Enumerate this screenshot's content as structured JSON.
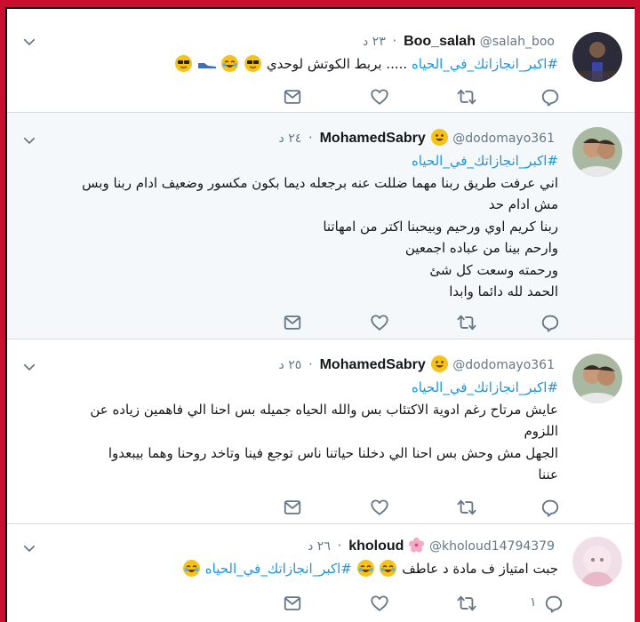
{
  "tweets": [
    {
      "name": "Boo_salah",
      "handle": "@salah_boo",
      "time": "٢٣ د",
      "tag": "#اكبر_انجازاتك_في_الحياه",
      "lines": [],
      "inline_text": "..... بربط الكوتش لوحدي",
      "reply_count": ""
    },
    {
      "name": "MohamedSabry",
      "handle": "@dodomayo361",
      "time": "٢٤ د",
      "tag": "#اكبر_انجازاتك_في_الحياه",
      "lines": [
        "اني عرفت طريق ربنا مهما ضللت عنه برجعله ديما بكون مكسور وضعيف ادام ربنا وبس",
        "مش ادام حد",
        "ربنا كريم اوي ورحيم وبيحبنا اكتر من امهاتنا",
        "وارحم بينا من عباده اجمعين",
        "ورحمته وسعت كل شئ",
        "الحمد لله دائما وابدا"
      ],
      "reply_count": ""
    },
    {
      "name": "MohamedSabry",
      "handle": "@dodomayo361",
      "time": "٢٥ د",
      "tag": "#اكبر_انجازاتك_في_الحياه",
      "lines": [
        "عايش مرتاح رغم ادوية الاكتئاب بس والله الحياه جميله بس احنا الي فاهمين زياده عن",
        "اللزوم",
        "الجهل مش وحش بس احنا الي دخلنا حياتنا ناس توجع فينا وتاخد روحنا وهما بيبعدوا",
        "عننا"
      ],
      "reply_count": ""
    },
    {
      "name": "kholoud",
      "handle": "@kholoud14794379",
      "time": "٢٦ د",
      "tag": "#اكبر_انجازاتك_في_الحياه",
      "lines": [],
      "inline_text": "جبت امتياز ف مادة د عاطف",
      "reply_count": "١"
    }
  ],
  "icons": [
    "chevron-down-icon",
    "reply-icon",
    "retweet-icon",
    "like-icon",
    "message-icon",
    "sunglasses-emoji",
    "joy-emoji",
    "grin-emoji",
    "cherry-blossom-emoji",
    "shoe-emoji"
  ],
  "colors": {
    "frame": "#c8102e",
    "link": "#1b95e0",
    "muted": "#657786",
    "text": "#14171a",
    "highlight_bg": "#f5f8fa"
  }
}
